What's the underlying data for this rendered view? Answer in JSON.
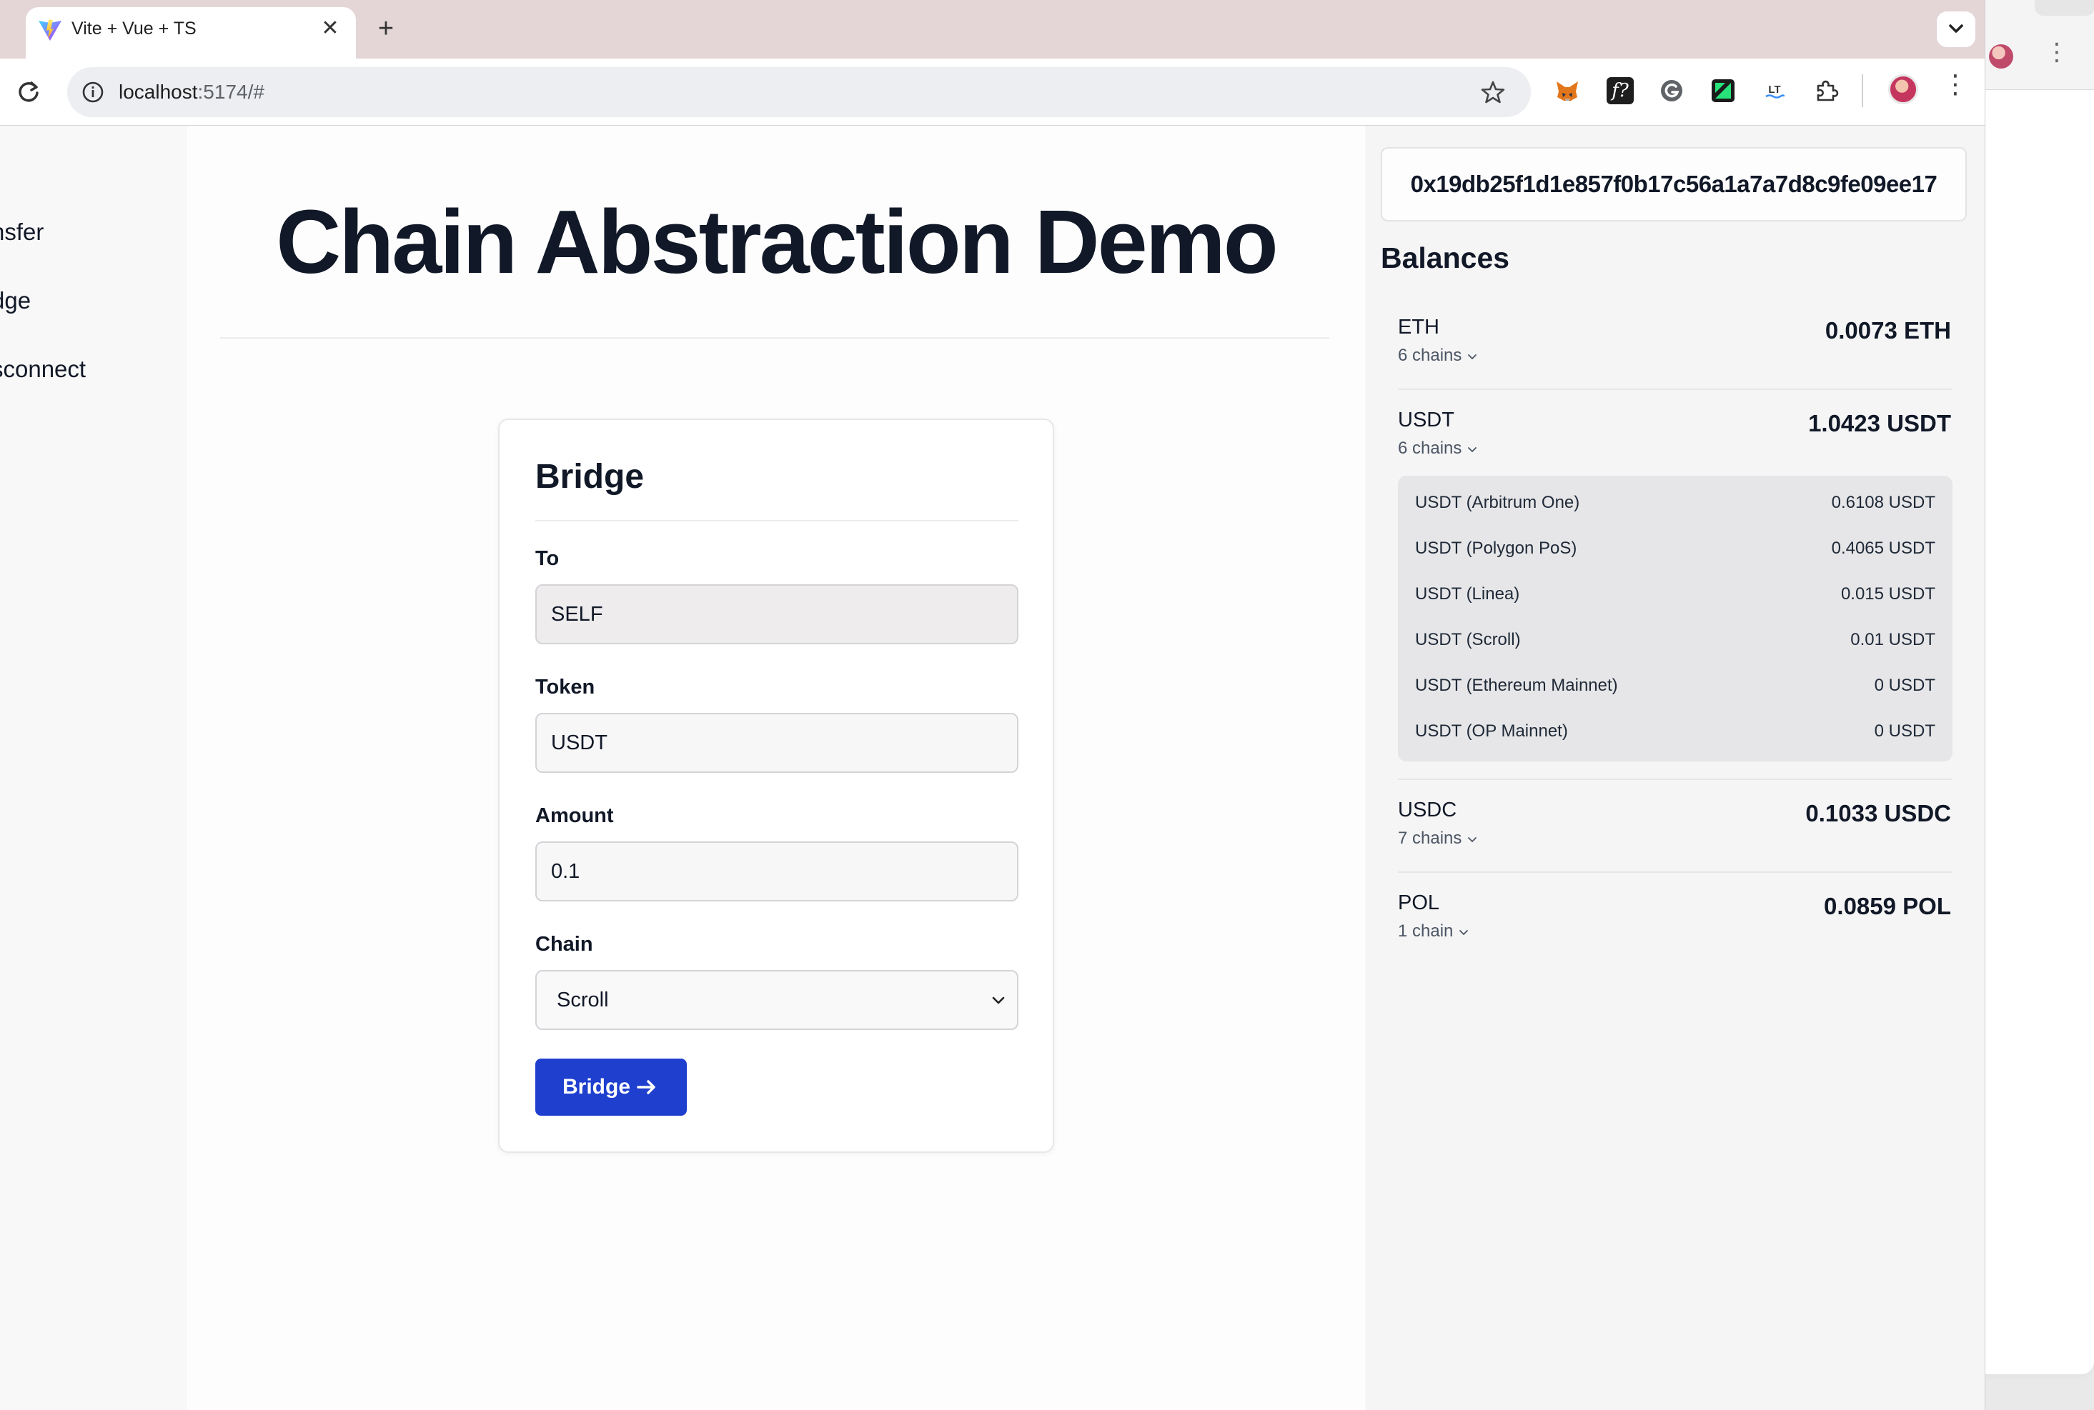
{
  "browser": {
    "tab": {
      "title": "Vite + Vue + TS"
    },
    "url": {
      "host": "localhost",
      "path": ":5174/#"
    }
  },
  "sidebar": {
    "items": [
      {
        "label": "nsfer"
      },
      {
        "label": "dge"
      },
      {
        "label": "sconnect"
      }
    ]
  },
  "main": {
    "title": "Chain Abstraction Demo",
    "card": {
      "title": "Bridge",
      "to_label": "To",
      "to_value": "SELF",
      "token_label": "Token",
      "token_value": "USDT",
      "amount_label": "Amount",
      "amount_value": "0.1",
      "chain_label": "Chain",
      "chain_value": "Scroll",
      "button_label": "Bridge"
    }
  },
  "wallet": {
    "address": "0x19db25f1d1e857f0b17c56a1a7a7d8c9fe09ee17",
    "balances_title": "Balances",
    "assets": [
      {
        "symbol": "ETH",
        "chains": "6 chains",
        "total": "0.0073 ETH"
      },
      {
        "symbol": "USDT",
        "chains": "6 chains",
        "total": "1.0423 USDT"
      },
      {
        "symbol": "USDC",
        "chains": "7 chains",
        "total": "0.1033 USDC"
      },
      {
        "symbol": "POL",
        "chains": "1 chain",
        "total": "0.0859 POL"
      }
    ],
    "usdt_breakdown": [
      {
        "name": "USDT (Arbitrum One)",
        "value": "0.6108 USDT"
      },
      {
        "name": "USDT (Polygon PoS)",
        "value": "0.4065 USDT"
      },
      {
        "name": "USDT (Linea)",
        "value": "0.015 USDT"
      },
      {
        "name": "USDT (Scroll)",
        "value": "0.01 USDT"
      },
      {
        "name": "USDT (Ethereum Mainnet)",
        "value": "0 USDT"
      },
      {
        "name": "USDT (OP Mainnet)",
        "value": "0 USDT"
      }
    ]
  },
  "colors": {
    "primary_button": "#1f3fcf",
    "tabstrip": "#e4d5d7"
  },
  "icons": [
    "vite-favicon",
    "close-icon",
    "plus-icon",
    "chevron-down-icon",
    "reload-icon",
    "site-info-icon",
    "star-icon",
    "metamask-icon",
    "function-icon",
    "grammarly-icon",
    "green-extension-icon",
    "languagetool-icon",
    "puzzle-icon",
    "profile-avatar",
    "kebab-menu-icon",
    "arrow-right-icon"
  ]
}
